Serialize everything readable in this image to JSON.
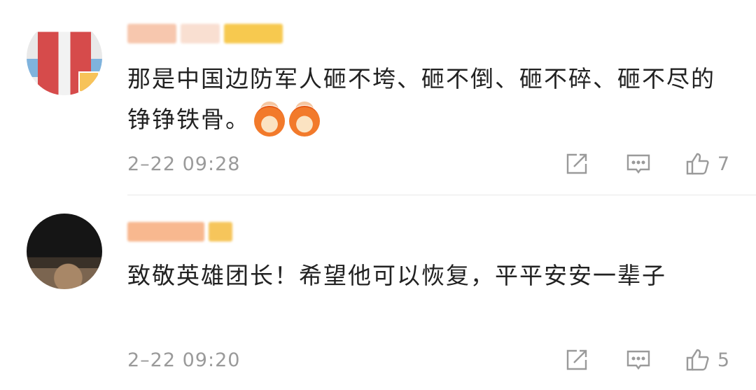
{
  "comments": [
    {
      "text": "那是中国边防军人砸不垮、砸不倒、砸不碎、砸不尽的铮铮铁骨。",
      "emoji": "fist-cheer-emoji",
      "time": "2–22 09:28",
      "likes": "7"
    },
    {
      "text": "致敬英雄团长！希望他可以恢复，平平安安一辈子",
      "time": "2–22 09:20",
      "likes": "5"
    }
  ],
  "icons": {
    "share": "share-icon",
    "reply": "comment-icon",
    "like": "thumbs-up-icon"
  },
  "colors": {
    "text": "#222222",
    "meta": "#9a9a9a",
    "divider": "#e8e8e8"
  }
}
